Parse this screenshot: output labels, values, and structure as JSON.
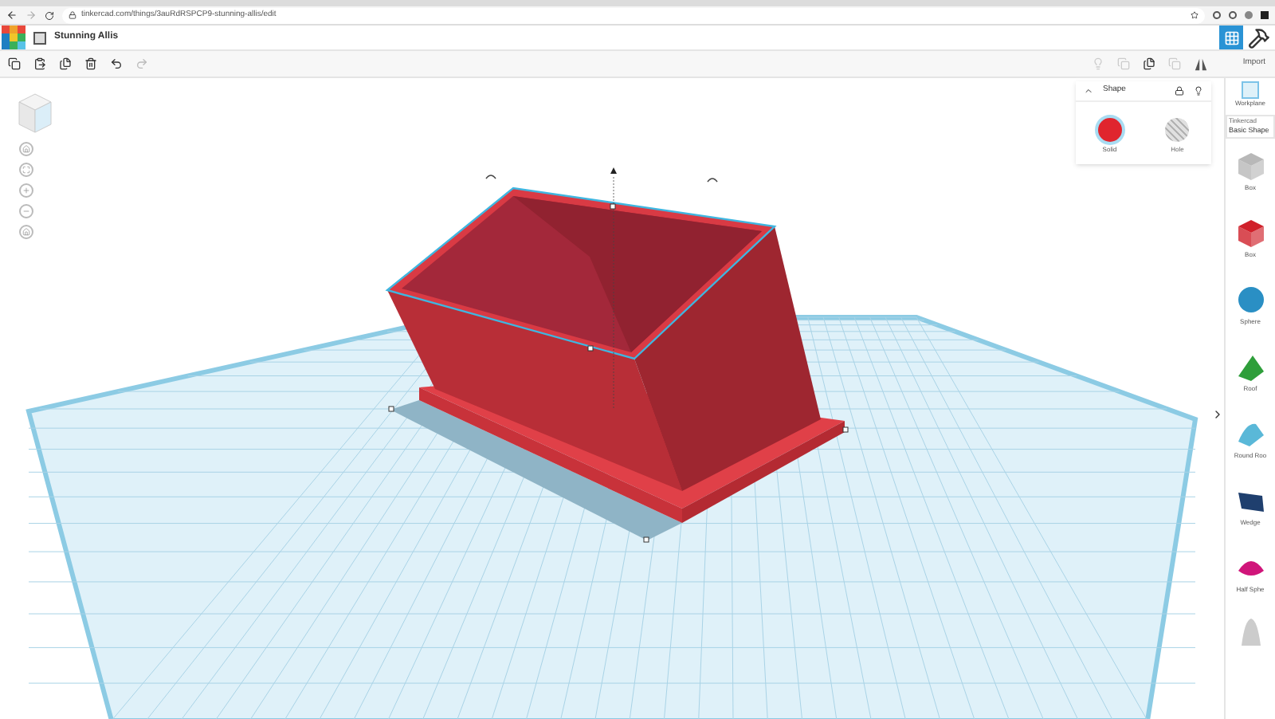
{
  "browser": {
    "url": "tinkercad.com/things/3auRdRSPCP9-stunning-allis/edit"
  },
  "header": {
    "title": "Stunning Allis"
  },
  "toolbar": {
    "import_label": "Import"
  },
  "shape_panel": {
    "title": "Shape",
    "options": [
      {
        "label": "Solid",
        "kind": "solid",
        "selected": true
      },
      {
        "label": "Hole",
        "kind": "hole",
        "selected": false
      }
    ]
  },
  "sidebar": {
    "workplane_label": "Workplane",
    "library_source": "Tinkercad",
    "library_category": "Basic Shape",
    "shapes": [
      {
        "label": "Box",
        "kind": "box",
        "color": "#b8b8b8"
      },
      {
        "label": "Box",
        "kind": "box",
        "color": "#d0202a"
      },
      {
        "label": "Sphere",
        "kind": "sphere",
        "color": "#2a8fc4"
      },
      {
        "label": "Roof",
        "kind": "roof",
        "color": "#2e9e3a"
      },
      {
        "label": "Round Roo",
        "kind": "roundroof",
        "color": "#5ab8d8"
      },
      {
        "label": "Wedge",
        "kind": "wedge",
        "color": "#1f3f6e"
      },
      {
        "label": "Half Sphe",
        "kind": "halfsphere",
        "color": "#d0157a"
      }
    ]
  }
}
